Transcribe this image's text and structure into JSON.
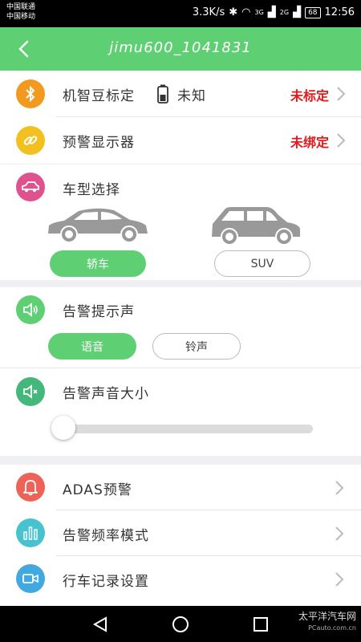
{
  "status_bar": {
    "carrier_line1": "中国联通",
    "carrier_line2": "中国移动",
    "speed": "3.3K/s",
    "network_3g": "3G",
    "network_2g": "2G",
    "battery": "68",
    "time": "12:56"
  },
  "header": {
    "title": "jimu600_1041831",
    "back_icon": "back-arrow-icon"
  },
  "device_rows": [
    {
      "label": "机智豆标定",
      "battery_text": "未知",
      "status": "未标定",
      "icon": "bluetooth-icon",
      "color": "#f29a1f"
    },
    {
      "label": "预警显示器",
      "status": "未绑定",
      "icon": "link-icon",
      "color": "#f2c11f"
    }
  ],
  "car_type": {
    "label": "车型选择",
    "icon": "car-icon",
    "color": "#e0528e",
    "options": [
      "轿车",
      "SUV"
    ],
    "selected": "轿车"
  },
  "alarm_sound": {
    "label": "告警提示声",
    "icon": "speaker-icon",
    "color": "#5fcf73",
    "options": [
      "语音",
      "铃声"
    ],
    "selected": "语音"
  },
  "volume": {
    "label": "告警声音大小",
    "icon": "volume-icon",
    "color": "#43b87a",
    "level": 0.0
  },
  "menu": [
    {
      "label": "ADAS预警",
      "icon": "bell-icon",
      "color": "#ef6258"
    },
    {
      "label": "告警频率模式",
      "icon": "bars-icon",
      "color": "#47c2ce"
    },
    {
      "label": "行车记录设置",
      "icon": "camera-icon",
      "color": "#42a8e0"
    }
  ],
  "watermark": {
    "line1": "太平洋汽车网",
    "line2": "PCauto.com.cn"
  }
}
